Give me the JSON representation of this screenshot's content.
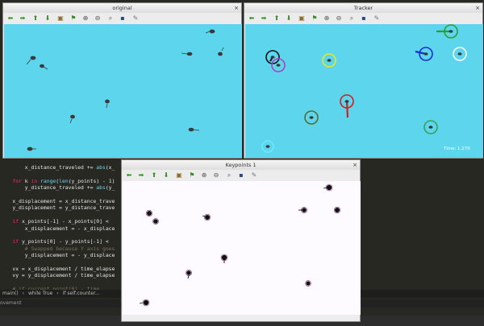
{
  "editor": {
    "lines": [
      {
        "parts": [
          {
            "t": "        x_distance_traveled += ",
            "c": ""
          },
          {
            "t": "abs",
            "c": "bi"
          },
          {
            "t": "(x_",
            "c": ""
          }
        ]
      },
      {
        "parts": [
          {
            "t": "",
            "c": ""
          }
        ]
      },
      {
        "parts": [
          {
            "t": "    ",
            "c": ""
          },
          {
            "t": "for",
            "c": "kw"
          },
          {
            "t": " k ",
            "c": ""
          },
          {
            "t": "in",
            "c": "kw"
          },
          {
            "t": " ",
            "c": ""
          },
          {
            "t": "range",
            "c": "bi"
          },
          {
            "t": "(",
            "c": ""
          },
          {
            "t": "len",
            "c": "bi"
          },
          {
            "t": "(y_points) - 1)",
            "c": ""
          }
        ]
      },
      {
        "parts": [
          {
            "t": "        y_distance_traveled += ",
            "c": ""
          },
          {
            "t": "abs",
            "c": "bi"
          },
          {
            "t": "(y_",
            "c": ""
          }
        ]
      },
      {
        "parts": [
          {
            "t": "",
            "c": ""
          }
        ]
      },
      {
        "parts": [
          {
            "t": "    x_displacement = x_distance_trave",
            "c": ""
          }
        ]
      },
      {
        "parts": [
          {
            "t": "    y_displacement = y_distance_trave",
            "c": ""
          }
        ]
      },
      {
        "parts": [
          {
            "t": "",
            "c": ""
          }
        ]
      },
      {
        "parts": [
          {
            "t": "    ",
            "c": ""
          },
          {
            "t": "if",
            "c": "kw"
          },
          {
            "t": " x_points[-1] - x_points[0] < ",
            "c": ""
          }
        ]
      },
      {
        "parts": [
          {
            "t": "        x_displacement = - x_displace",
            "c": ""
          }
        ]
      },
      {
        "parts": [
          {
            "t": "",
            "c": ""
          }
        ]
      },
      {
        "parts": [
          {
            "t": "    ",
            "c": ""
          },
          {
            "t": "if",
            "c": "kw"
          },
          {
            "t": " y_points[0] - y_points[-1] < ",
            "c": ""
          }
        ]
      },
      {
        "parts": [
          {
            "t": "        # Swapped because Y axis goes",
            "c": "cm"
          }
        ]
      },
      {
        "parts": [
          {
            "t": "        y_displacement = - y_displace",
            "c": ""
          }
        ]
      },
      {
        "parts": [
          {
            "t": "",
            "c": ""
          }
        ]
      },
      {
        "parts": [
          {
            "t": "    vx = x_displacement / time_elapse",
            "c": ""
          }
        ]
      },
      {
        "parts": [
          {
            "t": "    vy = y_displacement / time_elapse",
            "c": ""
          }
        ]
      },
      {
        "parts": [
          {
            "t": "",
            "c": ""
          }
        ]
      },
      {
        "parts": [
          {
            "t": "    # if current_point[0] - time",
            "c": "cm"
          }
        ]
      }
    ],
    "breadcrumb": [
      "main()",
      "while True",
      "if self.counter..."
    ],
    "bottom_label": "ovement"
  },
  "windows": {
    "original": {
      "title": "original",
      "close": "×",
      "bg": "#5dd5ec"
    },
    "tracker": {
      "title": "Tracker",
      "close": "×",
      "bg": "#5dd5ec",
      "time_text": "Time: 1.270"
    },
    "keypoints": {
      "title": "Keypoints 1",
      "close": "×",
      "bg": "#fdfbff"
    }
  },
  "toolbar_buttons": [
    {
      "name": "back-arrow-icon",
      "glyph": "⬅",
      "color": "#3a8a2a"
    },
    {
      "name": "forward-arrow-icon",
      "glyph": "➡",
      "color": "#3a8a2a"
    },
    {
      "name": "up-arrow-icon",
      "glyph": "⬆",
      "color": "#3a8a2a"
    },
    {
      "name": "down-arrow-icon",
      "glyph": "⬇",
      "color": "#3a8a2a"
    },
    {
      "name": "image-icon",
      "glyph": "▣",
      "color": "#8a6a2a"
    },
    {
      "name": "flag-icon",
      "glyph": "⚑",
      "color": "#3a8a2a"
    },
    {
      "name": "zoom-in-icon",
      "glyph": "⊕",
      "color": "#555"
    },
    {
      "name": "zoom-out-icon",
      "glyph": "⊖",
      "color": "#555"
    },
    {
      "name": "zoom-icon",
      "glyph": "⌕",
      "color": "#555"
    },
    {
      "name": "save-icon",
      "glyph": "▪",
      "color": "#2a4a8a"
    },
    {
      "name": "brush-icon",
      "glyph": "✎",
      "color": "#777"
    }
  ],
  "colors": {
    "tadpole": "#3a3a3a",
    "keypoint": "#111111",
    "keypoint_ring": "#7a2a7a"
  }
}
